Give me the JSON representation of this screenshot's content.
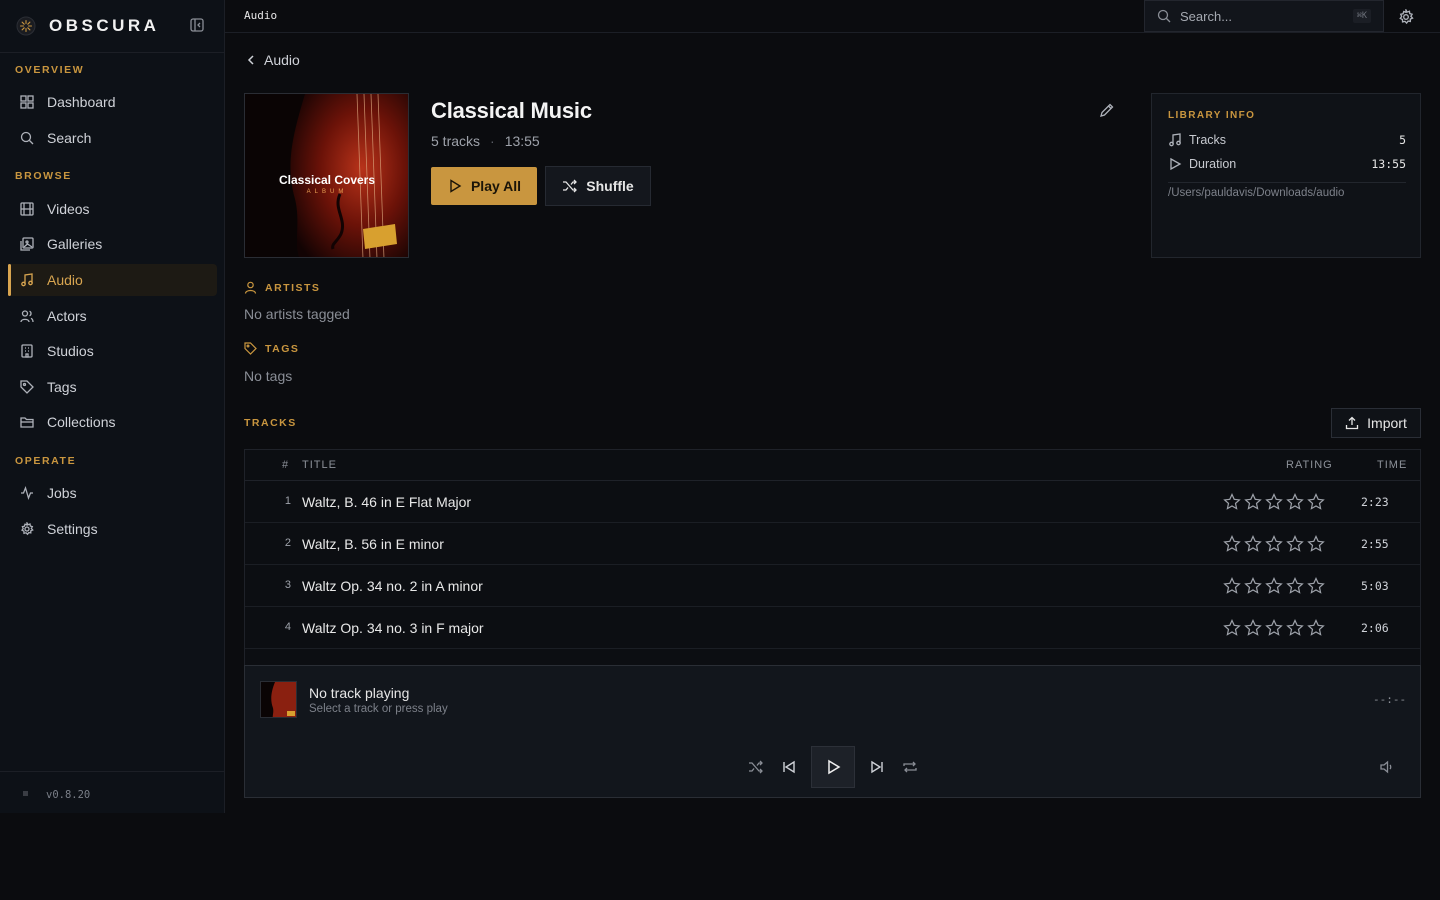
{
  "app": {
    "brand": "OBSCURA",
    "version": "v0.8.20"
  },
  "topbar": {
    "breadcrumb": "Audio",
    "search_placeholder": "Search...",
    "search_shortcut": "⌘K"
  },
  "sidebar": {
    "sections": [
      {
        "label": "OVERVIEW",
        "items": [
          {
            "label": "Dashboard",
            "icon": "grid-icon"
          },
          {
            "label": "Search",
            "icon": "search-icon"
          }
        ]
      },
      {
        "label": "BROWSE",
        "items": [
          {
            "label": "Videos",
            "icon": "film-icon"
          },
          {
            "label": "Galleries",
            "icon": "images-icon"
          },
          {
            "label": "Audio",
            "icon": "music-icon",
            "active": true
          },
          {
            "label": "Actors",
            "icon": "users-icon"
          },
          {
            "label": "Studios",
            "icon": "building-icon"
          },
          {
            "label": "Tags",
            "icon": "tag-icon"
          },
          {
            "label": "Collections",
            "icon": "folder-icon"
          }
        ]
      },
      {
        "label": "OPERATE",
        "items": [
          {
            "label": "Jobs",
            "icon": "activity-icon"
          },
          {
            "label": "Settings",
            "icon": "gear-icon"
          }
        ]
      }
    ]
  },
  "main": {
    "back_label": "Audio",
    "album": {
      "title": "Classical Music",
      "track_count": "5 tracks",
      "duration": "13:55",
      "cover_title": "Classical Covers",
      "cover_subtitle": "ALBUM"
    },
    "actions": {
      "play_all": "Play All",
      "shuffle": "Shuffle",
      "import": "Import"
    },
    "library_info": {
      "heading": "LIBRARY INFO",
      "tracks_label": "Tracks",
      "tracks_value": "5",
      "duration_label": "Duration",
      "duration_value": "13:55",
      "path": "/Users/pauldavis/Downloads/audio"
    },
    "artists": {
      "heading": "ARTISTS",
      "empty": "No artists tagged"
    },
    "tags": {
      "heading": "TAGS",
      "empty": "No tags"
    },
    "tracks": {
      "heading": "TRACKS",
      "columns": {
        "num": "#",
        "title": "TITLE",
        "rating": "RATING",
        "time": "TIME"
      },
      "rows": [
        {
          "num": "1",
          "title": "Waltz, B. 46 in E Flat Major",
          "rating": 0,
          "time": "2:23"
        },
        {
          "num": "2",
          "title": "Waltz, B. 56 in E minor",
          "rating": 0,
          "time": "2:55"
        },
        {
          "num": "3",
          "title": "Waltz Op. 34 no. 2 in A minor",
          "rating": 0,
          "time": "5:03"
        },
        {
          "num": "4",
          "title": "Waltz Op. 34 no. 3 in F major",
          "rating": 0,
          "time": "2:06"
        }
      ]
    }
  },
  "player": {
    "title": "No track playing",
    "subtitle": "Select a track or press play",
    "time": "--:--"
  },
  "colors": {
    "accent": "#c9963f",
    "bg": "#0b0c0f",
    "sidebar": "#0d1117"
  }
}
